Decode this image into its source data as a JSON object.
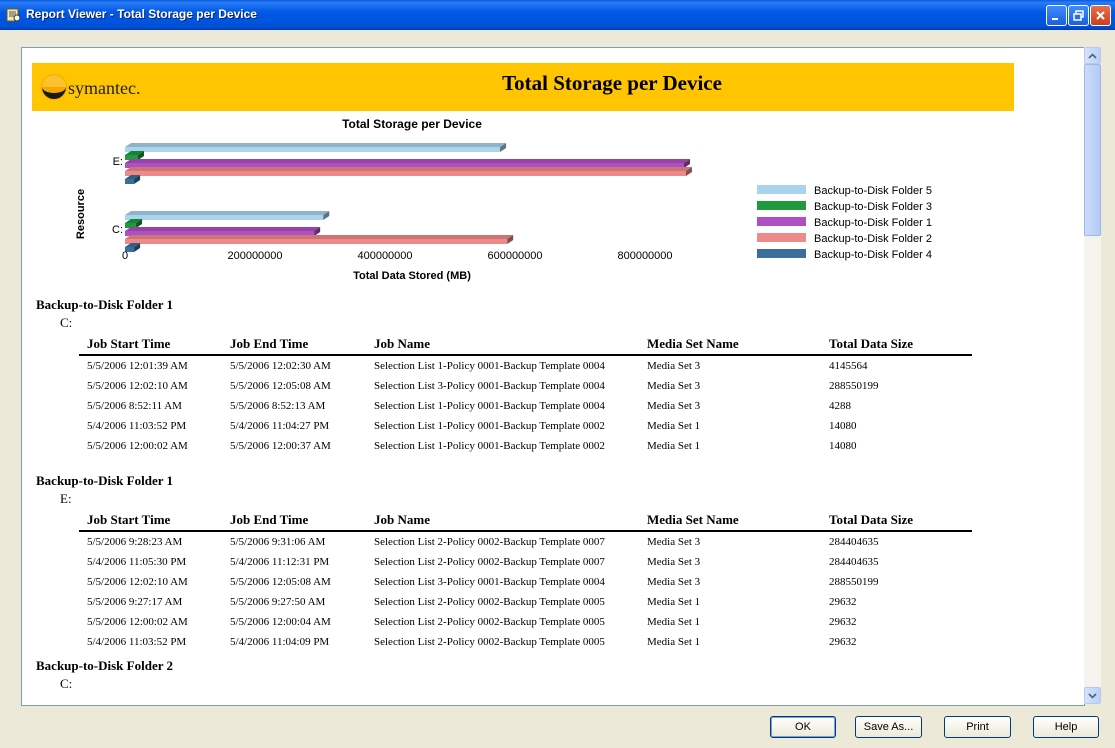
{
  "window": {
    "title": "Report Viewer - Total Storage per Device"
  },
  "report": {
    "brand": "symantec.",
    "title": "Total Storage per Device"
  },
  "chart_data": {
    "type": "bar",
    "orientation": "horizontal",
    "title": "Total Storage per Device",
    "xlabel": "Total Data Stored (MB)",
    "ylabel": "Resource",
    "categories": [
      "E:",
      "C:"
    ],
    "xlim": [
      0,
      1000000000
    ],
    "xticks": [
      "0",
      "200000000",
      "400000000",
      "600000000",
      "800000000"
    ],
    "legend_position": "right",
    "series": [
      {
        "name": "Backup-to-Disk Folder 5",
        "color": "#a8d4ec",
        "values": [
          577000000,
          305000000
        ]
      },
      {
        "name": "Backup-to-Disk Folder 3",
        "color": "#1f9a3c",
        "values": [
          20000000,
          17000000
        ]
      },
      {
        "name": "Backup-to-Disk Folder 1",
        "color": "#b04fc4",
        "values": [
          860000000,
          291000000
        ]
      },
      {
        "name": "Backup-to-Disk Folder 2",
        "color": "#f08a8a",
        "values": [
          863000000,
          588000000
        ]
      },
      {
        "name": "Backup-to-Disk Folder 4",
        "color": "#3a6e9c",
        "values": [
          14000000,
          14000000
        ]
      }
    ]
  },
  "table_headers": [
    "Job Start Time",
    "Job End Time",
    "Job Name",
    "Media Set Name",
    "Total Data Size"
  ],
  "sections": [
    {
      "folder": "Backup-to-Disk Folder 1",
      "resource": "C:",
      "rows": [
        [
          "5/5/2006 12:01:39 AM",
          "5/5/2006 12:02:30 AM",
          "Selection List 1-Policy 0001-Backup Template 0004",
          "Media Set 3",
          "4145564"
        ],
        [
          "5/5/2006 12:02:10 AM",
          "5/5/2006 12:05:08 AM",
          "Selection List 3-Policy 0001-Backup Template 0004",
          "Media Set 3",
          "288550199"
        ],
        [
          "5/5/2006 8:52:11 AM",
          "5/5/2006 8:52:13 AM",
          "Selection List 1-Policy 0001-Backup Template 0004",
          "Media Set 3",
          "4288"
        ],
        [
          "5/4/2006 11:03:52 PM",
          "5/4/2006 11:04:27 PM",
          "Selection List 1-Policy 0001-Backup Template 0002",
          "Media Set 1",
          "14080"
        ],
        [
          "5/5/2006 12:00:02 AM",
          "5/5/2006 12:00:37 AM",
          "Selection List 1-Policy 0001-Backup Template 0002",
          "Media Set 1",
          "14080"
        ]
      ]
    },
    {
      "folder": "Backup-to-Disk Folder 1",
      "resource": "E:",
      "rows": [
        [
          "5/5/2006 9:28:23 AM",
          "5/5/2006 9:31:06 AM",
          "Selection List 2-Policy 0002-Backup Template 0007",
          "Media Set 3",
          "284404635"
        ],
        [
          "5/4/2006 11:05:30 PM",
          "5/4/2006 11:12:31 PM",
          "Selection List 2-Policy 0002-Backup Template 0007",
          "Media Set 3",
          "284404635"
        ],
        [
          "5/5/2006 12:02:10 AM",
          "5/5/2006 12:05:08 AM",
          "Selection List 3-Policy 0001-Backup Template 0004",
          "Media Set 3",
          "288550199"
        ],
        [
          "5/5/2006 9:27:17 AM",
          "5/5/2006 9:27:50 AM",
          "Selection List 2-Policy 0002-Backup Template 0005",
          "Media Set 1",
          "29632"
        ],
        [
          "5/5/2006 12:00:02 AM",
          "5/5/2006 12:00:04 AM",
          "Selection List 2-Policy 0002-Backup Template 0005",
          "Media Set 1",
          "29632"
        ],
        [
          "5/4/2006 11:03:52 PM",
          "5/4/2006 11:04:09 PM",
          "Selection List 2-Policy 0002-Backup Template 0005",
          "Media Set 1",
          "29632"
        ]
      ]
    },
    {
      "folder": "Backup-to-Disk Folder 2",
      "resource": "C:",
      "rows": []
    }
  ],
  "buttons": {
    "ok": "OK",
    "save_as": "Save As...",
    "print": "Print",
    "help": "Help"
  }
}
